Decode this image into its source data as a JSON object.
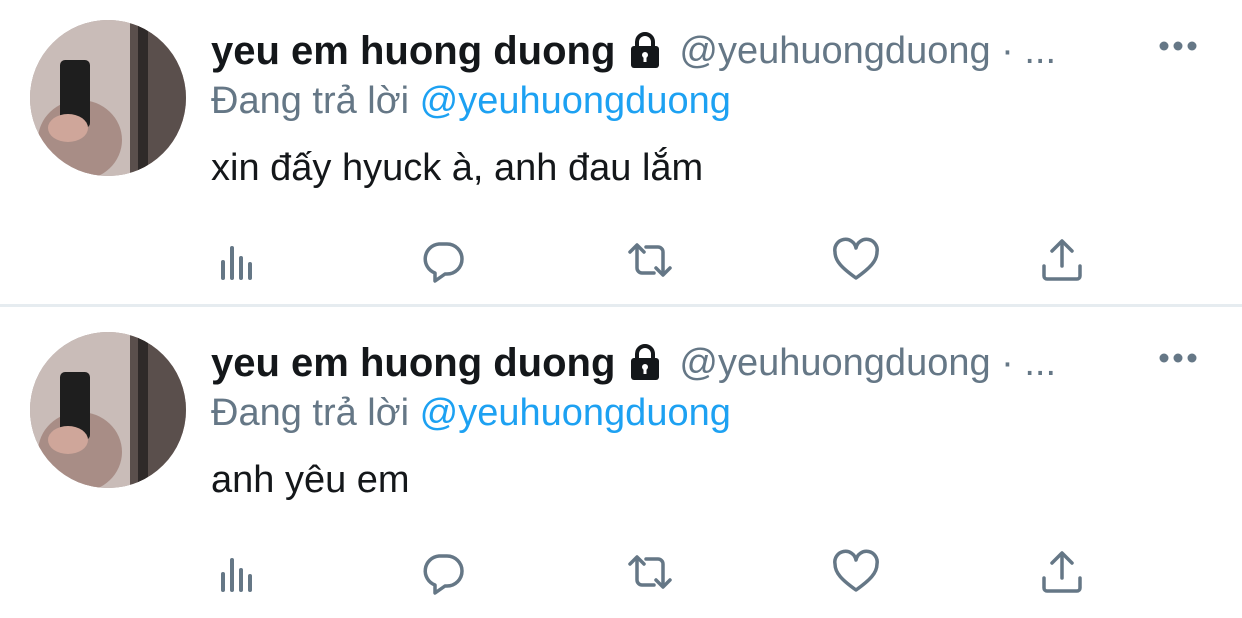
{
  "tweets": [
    {
      "display_name": "yeu em huong duong",
      "handle": "@yeuhuongduong · ...",
      "replying_prefix": "Đang trả lời",
      "replying_to": "@yeuhuongduong",
      "text": "xin đấy hyuck à, anh đau lắm"
    },
    {
      "display_name": "yeu em huong duong",
      "handle": "@yeuhuongduong · ...",
      "replying_prefix": "Đang trả lời",
      "replying_to": "@yeuhuongduong",
      "text": "anh yêu em"
    }
  ],
  "icons": {
    "protected": "lock-icon",
    "more": "more-dots-icon",
    "analytics": "analytics-icon",
    "reply": "reply-icon",
    "retweet": "retweet-icon",
    "like": "heart-icon",
    "share": "share-icon"
  },
  "colors": {
    "text": "#14171a",
    "secondary": "#657786",
    "mention": "#1da1f2",
    "divider": "#e6ecf0"
  }
}
